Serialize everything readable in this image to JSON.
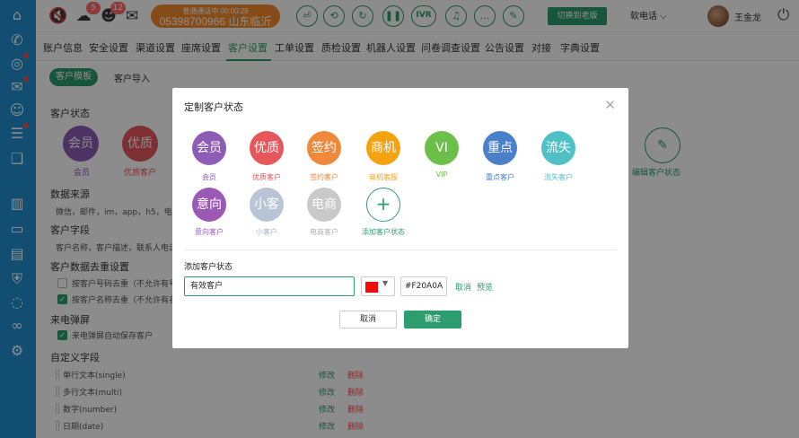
{
  "topbar": {
    "badges": {
      "messages": "5",
      "notifications": "12"
    },
    "call_status_line1": "普通通话中 00:00:28",
    "call_status_line2": "05398700966 山东临沂",
    "controls": [
      "⏎",
      "⟲",
      "↻",
      "❚❚",
      "IVR",
      "♫",
      "…",
      "✎"
    ],
    "switch_label": "切换到老版",
    "phone_mode": "软电话 ⌵",
    "user_name": "王金龙"
  },
  "nav": {
    "items": [
      "账户信息",
      "安全设置",
      "渠道设置",
      "座席设置",
      "客户设置",
      "工单设置",
      "质检设置",
      "机器人设置",
      "问卷调查设置",
      "公告设置",
      "对接",
      "字典设置"
    ],
    "active_index": 4
  },
  "subtabs": {
    "active": "客户模板",
    "other": "客户导入"
  },
  "page": {
    "customer_status_title": "客户状态",
    "statuses": [
      {
        "text": "会员",
        "label": "会员",
        "color": "#8e5bb5"
      },
      {
        "text": "优质",
        "label": "优质客户",
        "color": "#e6565a"
      }
    ],
    "edit_status_label": "编辑客户状态",
    "data_source_title": "数据来源",
    "data_source_text": "微信，邮件，im，app，h5，电话",
    "customer_fields_title": "客户字段",
    "customer_fields_text": "客户名称，客户描述，联系人电话",
    "dedupe_title": "客户数据去重设置",
    "dedupe_opt1": "按客户号码去重（不允许有号",
    "dedupe_opt2": "按客户名称去重（不允许有名",
    "popup_title": "来电弹屏",
    "popup_opt": "来电弹屏自动保存客户",
    "custom_fields_title": "自定义字段",
    "custom_fields": [
      "单行文本(single)",
      "多行文本(multi)",
      "数字(number)",
      "日期(date)"
    ],
    "edit_label": "修改",
    "delete_label": "删除"
  },
  "modal": {
    "title": "定制客户状态",
    "statuses": [
      {
        "text": "会员",
        "label": "会员",
        "color": "#8e5bb5"
      },
      {
        "text": "优质",
        "label": "优质客户",
        "color": "#e6565a"
      },
      {
        "text": "签约",
        "label": "签约客户",
        "color": "#ef8a3c"
      },
      {
        "text": "商机",
        "label": "商机客服",
        "color": "#f5a20f"
      },
      {
        "text": "VI",
        "label": "VIP",
        "color": "#6cc04a"
      },
      {
        "text": "重点",
        "label": "重点客户",
        "color": "#4a7fc9"
      },
      {
        "text": "流失",
        "label": "流失客户",
        "color": "#4fc1c4"
      },
      {
        "text": "意向",
        "label": "意向客户",
        "color": "#9b59b6"
      },
      {
        "text": "小客",
        "label": "小客户",
        "color": "#b8c5d8"
      },
      {
        "text": "电商",
        "label": "电商客户",
        "color": "#c9c9c9"
      }
    ],
    "add_label": "添加客户状态",
    "add_title": "添加客户状态",
    "input_value": "有效客户",
    "color_hex": "#F20A0A",
    "cancel_link": "取消",
    "preview_link": "预览",
    "cancel_button": "取消",
    "ok_button": "确定"
  }
}
